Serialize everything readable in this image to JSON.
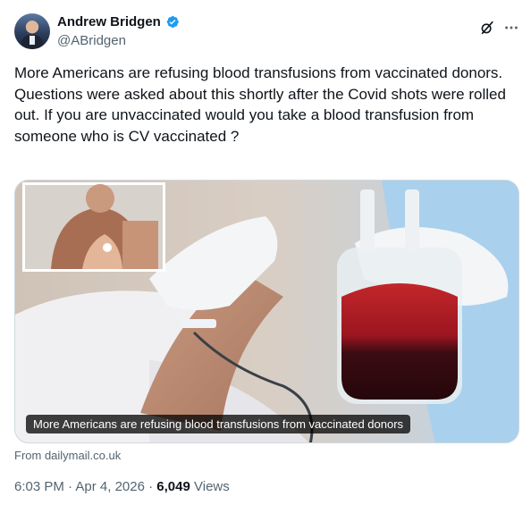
{
  "author": {
    "name": "Andrew Bridgen",
    "handle": "@ABridgen",
    "verified": true,
    "verified_color": "#1d9bf0"
  },
  "icons": {
    "grok": "grok-icon",
    "more": "more-icon"
  },
  "tweet": {
    "lines": [
      "More Americans are refusing blood transfusions from vaccinated donors.",
      "Questions were asked about this shortly after the Covid shots were rolled out. If you are unvaccinated would you take a blood transfusion from someone who is CV vaccinated ?"
    ]
  },
  "card": {
    "caption": "More Americans are refusing blood transfusions from vaccinated donors",
    "source": "From dailymail.co.uk"
  },
  "meta": {
    "time": "6:03 PM",
    "separator": "·",
    "date": "Apr 4, 2026",
    "views_count": "6,049",
    "views_label": "Views"
  }
}
